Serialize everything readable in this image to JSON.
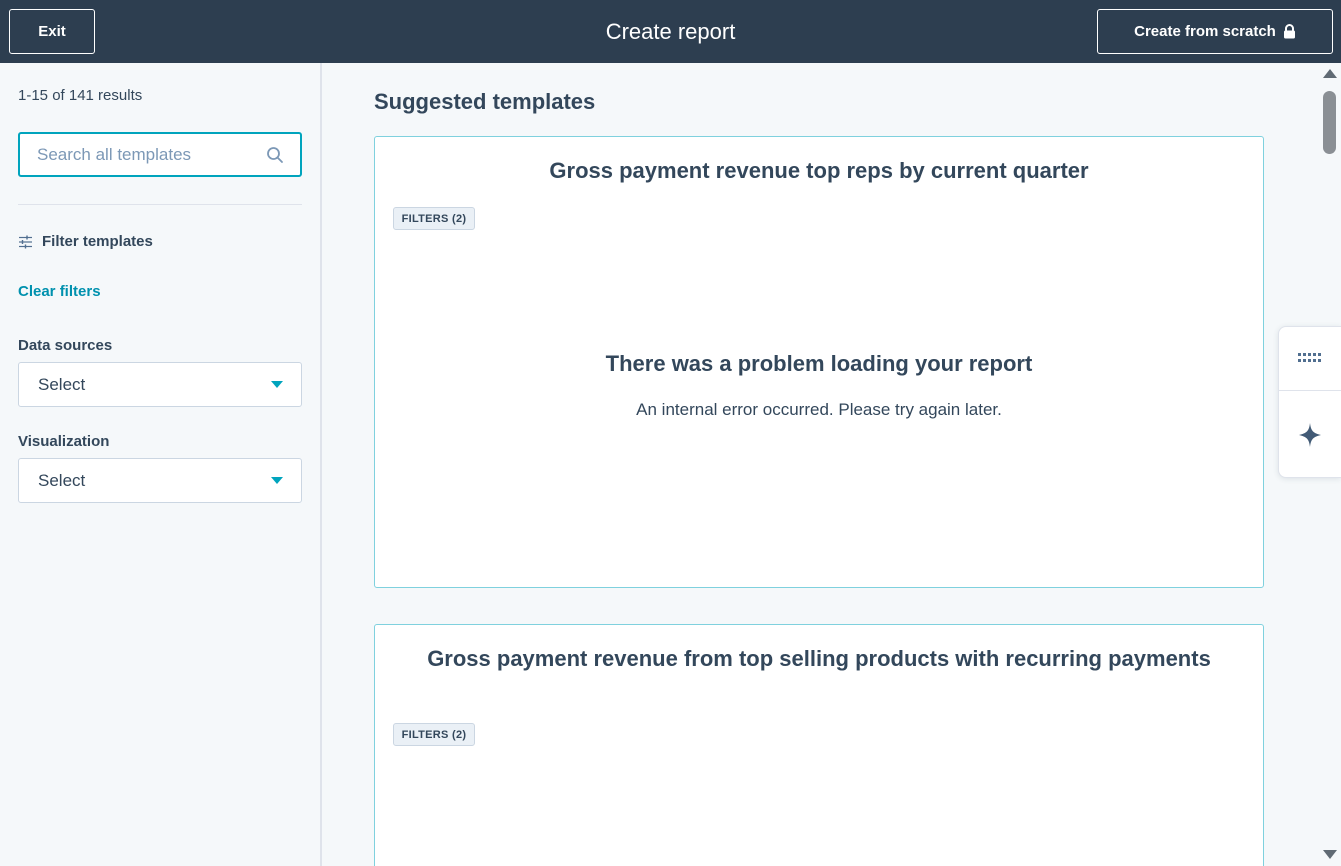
{
  "header": {
    "exit_label": "Exit",
    "title": "Create report",
    "create_from_scratch_label": "Create from scratch",
    "create_from_scratch_icon": "lock-icon"
  },
  "sidebar": {
    "results_count": "1-15 of 141 results",
    "search": {
      "value": "",
      "placeholder": "Search all templates",
      "icon": "search-icon"
    },
    "filter_heading": "Filter templates",
    "filter_icon": "sliders-icon",
    "clear_filters_label": "Clear filters",
    "fields": [
      {
        "label": "Data sources",
        "value": "Select"
      },
      {
        "label": "Visualization",
        "value": "Select"
      }
    ]
  },
  "main": {
    "section_title": "Suggested templates",
    "cards": [
      {
        "title": "Gross payment revenue top reps by current quarter",
        "filters_tag": "FILTERS (2)",
        "error_title": "There was a problem loading your report",
        "error_message": "An internal error occurred. Please try again later."
      },
      {
        "title": "Gross payment revenue from top selling products with recurring payments",
        "filters_tag": "FILTERS (2)"
      }
    ]
  },
  "dock": {
    "items": [
      {
        "icon": "grid-dots-icon"
      },
      {
        "icon": "sparkle-icon"
      }
    ]
  },
  "colors": {
    "header_bg": "#2d3e50",
    "accent_teal": "#00a4bd",
    "link_teal": "#0091ae",
    "text_primary": "#33475b",
    "card_border": "#7fd1de",
    "page_bg": "#f5f8fa"
  }
}
